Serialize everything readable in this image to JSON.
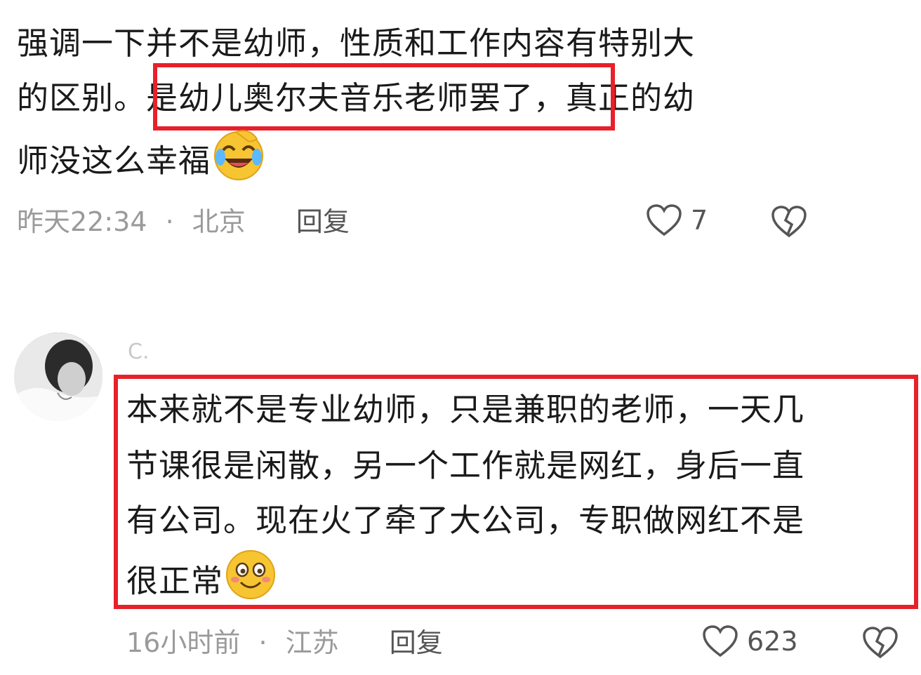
{
  "comment1": {
    "lines": [
      "强调一下并不是幼师，性质和工作内容有特别大",
      "的区别。",
      "是幼儿奥尔夫音乐老师罢了",
      "，真正的幼",
      "师没这么幸福"
    ],
    "emoji": "laughing-crying-emoji",
    "time": "昨天22:34",
    "dot": "·",
    "location": "北京",
    "reply_label": "回复",
    "like_count": "7"
  },
  "comment2": {
    "username": "C.",
    "lines": [
      "本来就不是专业幼师，只是兼职的老师，一天几",
      "节课很是闲散，另一个工作就是网红，身后一直",
      "有公司。现在火了牵了大公司，专职做网红不是",
      "很正常"
    ],
    "emoji": "blushing-smile-emoji",
    "time": "16小时前",
    "dot": "·",
    "location": "江苏",
    "reply_label": "回复",
    "like_count": "623"
  },
  "colors": {
    "highlight": "#e8202a",
    "meta_text": "#9a9a9a",
    "body_text": "#1a1a1a"
  }
}
